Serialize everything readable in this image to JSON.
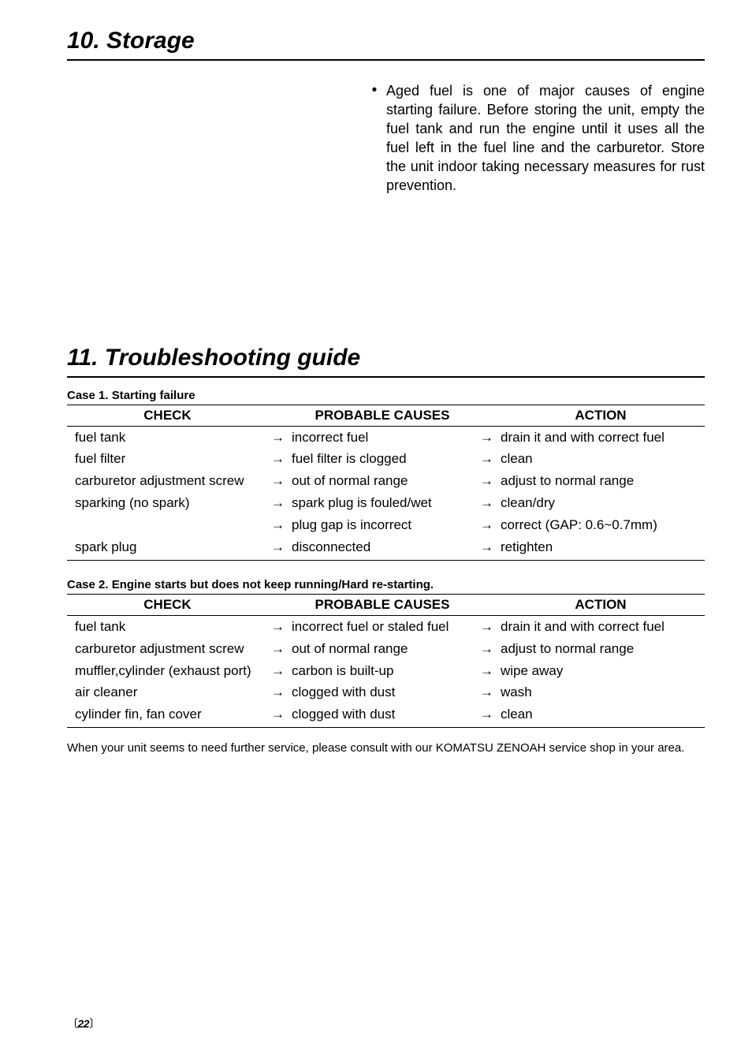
{
  "section1": {
    "heading": "10. Storage",
    "bullet": "Aged fuel is one of major causes of engine starting failure. Before storing the unit, empty the fuel tank and run the engine until it uses all the fuel left in the fuel line and the carburetor. Store the unit indoor taking necessary measures for rust prevention."
  },
  "section2": {
    "heading": "11. Troubleshooting guide"
  },
  "headers": {
    "check": "CHECK",
    "cause": "PROBABLE CAUSES",
    "action": "ACTION"
  },
  "arrow": "→",
  "case1": {
    "title": "Case 1. Starting failure",
    "rows": [
      {
        "check": "fuel tank",
        "a1": true,
        "cause": "incorrect fuel",
        "a2": true,
        "action": "drain it and with correct fuel"
      },
      {
        "check": "fuel filter",
        "a1": true,
        "cause": "fuel filter is clogged",
        "a2": true,
        "action": "clean"
      },
      {
        "check": "carburetor adjustment screw",
        "a1": true,
        "cause": "out of normal range",
        "a2": true,
        "action": "adjust to normal range"
      },
      {
        "check": "sparking (no spark)",
        "a1": true,
        "cause": "spark plug is fouled/wet",
        "a2": true,
        "action": "clean/dry"
      },
      {
        "check": "",
        "a1": true,
        "cause": "plug gap is incorrect",
        "a2": true,
        "action": "correct (GAP: 0.6~0.7mm)"
      },
      {
        "check": "spark plug",
        "a1": true,
        "cause": "disconnected",
        "a2": true,
        "action": "retighten"
      }
    ]
  },
  "case2": {
    "title": "Case 2. Engine starts but does not keep running/Hard re-starting.",
    "rows": [
      {
        "check": "fuel tank",
        "a1": true,
        "cause": "incorrect fuel or staled fuel",
        "a2": true,
        "action": "drain it and with correct fuel"
      },
      {
        "check": "carburetor adjustment screw",
        "a1": true,
        "cause": "out of normal range",
        "a2": true,
        "action": "adjust to normal range"
      },
      {
        "check": "muffler,cylinder (exhaust port)",
        "a1": true,
        "cause": "carbon is built-up",
        "a2": true,
        "action": "wipe away"
      },
      {
        "check": "air cleaner",
        "a1": true,
        "cause": "clogged with dust",
        "a2": true,
        "action": "wash"
      },
      {
        "check": "cylinder fin, fan cover",
        "a1": true,
        "cause": "clogged with dust",
        "a2": true,
        "action": "clean"
      }
    ]
  },
  "closing": "When your unit seems to need further service, please consult with our KOMATSU ZENOAH service shop in your area.",
  "page": {
    "open": "〔",
    "num": "22",
    "close": "〕"
  }
}
